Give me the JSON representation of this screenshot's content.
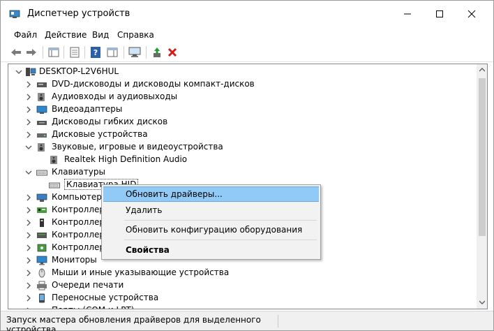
{
  "window": {
    "title": "Диспетчер устройств"
  },
  "menu": [
    "Файл",
    "Действие",
    "Вид",
    "Справка"
  ],
  "tree": {
    "root": "DESKTOP-L2V6HUL",
    "items": [
      {
        "label": "DVD-дисководы и дисководы компакт-дисков",
        "icon": "dvd-drive-icon",
        "expanded": false
      },
      {
        "label": "Аудиовходы и аудиовыходы",
        "icon": "speaker-icon",
        "expanded": false
      },
      {
        "label": "Видеоадаптеры",
        "icon": "display-adapter-icon",
        "expanded": false
      },
      {
        "label": "Дисководы гибких дисков",
        "icon": "floppy-drive-icon",
        "expanded": false
      },
      {
        "label": "Дисковые устройства",
        "icon": "disk-drive-icon",
        "expanded": false
      },
      {
        "label": "Звуковые, игровые и видеоустройства",
        "icon": "speaker-icon",
        "expanded": true
      },
      {
        "label": "Realtek High Definition Audio",
        "icon": "speaker-icon",
        "child": true
      },
      {
        "label": "Клавиатуры",
        "icon": "keyboard-icon",
        "expanded": true
      },
      {
        "label": "Клавиатура HID",
        "icon": "keyboard-icon",
        "child": true,
        "selected": true
      },
      {
        "label": "Компьютер",
        "icon": "computer-icon",
        "expanded": false
      },
      {
        "label": "Контроллеры",
        "icon": "controller-icon",
        "expanded": false
      },
      {
        "label": "Контроллеры",
        "icon": "usb-controller-icon",
        "expanded": false
      },
      {
        "label": "Контроллеры",
        "icon": "storage-controller-icon",
        "expanded": false
      },
      {
        "label": "Контроллеры",
        "icon": "ide-controller-icon",
        "expanded": false
      },
      {
        "label": "Мониторы",
        "icon": "monitor-icon",
        "expanded": false
      },
      {
        "label": "Мыши и иные указывающие устройства",
        "icon": "mouse-icon",
        "expanded": false
      },
      {
        "label": "Очереди печати",
        "icon": "printer-icon",
        "expanded": false
      },
      {
        "label": "Переносные устройства",
        "icon": "portable-device-icon",
        "expanded": false
      },
      {
        "label": "Порты (COM и LPT)",
        "icon": "port-icon",
        "expanded": false
      }
    ]
  },
  "context_menu": {
    "items": [
      "Обновить драйверы...",
      "Удалить",
      "Обновить конфигурацию оборудования",
      "Свойства"
    ],
    "highlighted": "Обновить драйверы...",
    "bold": "Свойства"
  },
  "status": {
    "text": "Запуск мастера обновления драйверов для выделенного устройства."
  },
  "colors": {
    "selection": "#91c9f7",
    "delete_red": "#d11a1a",
    "chevron": "#555555"
  }
}
